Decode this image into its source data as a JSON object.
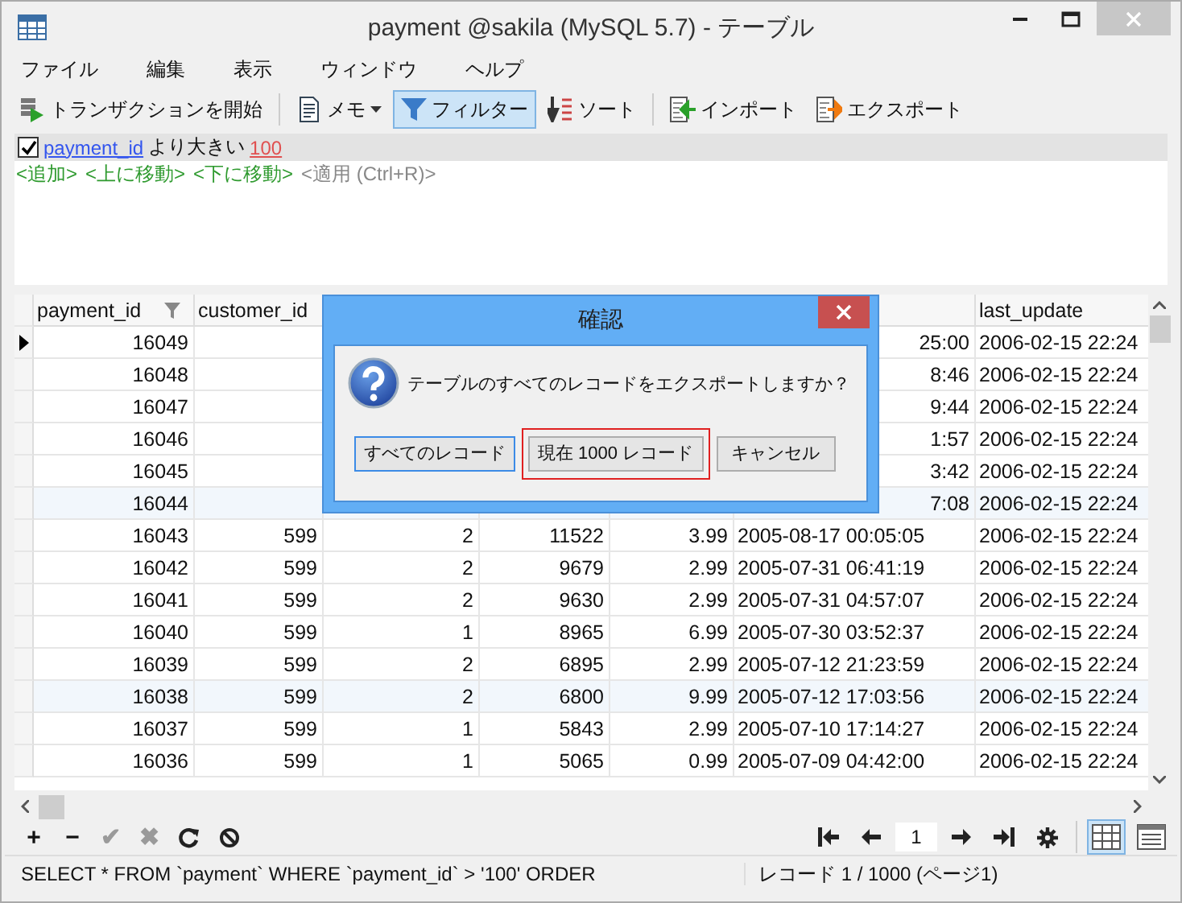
{
  "window": {
    "title": "payment @sakila (MySQL 5.7) - テーブル"
  },
  "menu": [
    "ファイル",
    "編集",
    "表示",
    "ウィンドウ",
    "ヘルプ"
  ],
  "toolbar": [
    {
      "label": "トランザクションを開始",
      "selected": false,
      "dropdown": false
    },
    {
      "label": "メモ",
      "selected": false,
      "dropdown": true
    },
    {
      "label": "フィルター",
      "selected": true,
      "dropdown": false
    },
    {
      "label": "ソート",
      "selected": false,
      "dropdown": false
    },
    {
      "label": "インポート",
      "selected": false,
      "dropdown": false
    },
    {
      "label": "エクスポート",
      "selected": false,
      "dropdown": false
    }
  ],
  "filter": {
    "checked": true,
    "field": "payment_id",
    "operator": "より大きい",
    "value": "100",
    "actions": [
      {
        "label": "<追加>",
        "disabled": false
      },
      {
        "label": "<上に移動>",
        "disabled": false
      },
      {
        "label": "<下に移動>",
        "disabled": false
      },
      {
        "label": "<適用 (Ctrl+R)>",
        "disabled": true
      }
    ]
  },
  "table": {
    "columns": [
      {
        "label": "payment_id"
      },
      {
        "label": "customer_id"
      },
      {},
      {},
      {},
      {},
      {
        "label": "last_update"
      }
    ],
    "rows": [
      {
        "current": true,
        "highlighted": false,
        "cells": [
          "16049",
          null,
          null,
          null,
          null,
          "25:00",
          "2006-02-15 22:24"
        ]
      },
      {
        "current": false,
        "highlighted": false,
        "cells": [
          "16048",
          null,
          null,
          null,
          null,
          "8:46",
          "2006-02-15 22:24"
        ]
      },
      {
        "current": false,
        "highlighted": false,
        "cells": [
          "16047",
          null,
          null,
          null,
          null,
          "9:44",
          "2006-02-15 22:24"
        ]
      },
      {
        "current": false,
        "highlighted": false,
        "cells": [
          "16046",
          null,
          null,
          null,
          null,
          "1:57",
          "2006-02-15 22:24"
        ]
      },
      {
        "current": false,
        "highlighted": false,
        "cells": [
          "16045",
          null,
          null,
          null,
          null,
          "3:42",
          "2006-02-15 22:24"
        ]
      },
      {
        "current": false,
        "highlighted": true,
        "cells": [
          "16044",
          null,
          null,
          null,
          null,
          "7:08",
          "2006-02-15 22:24"
        ]
      },
      {
        "current": false,
        "highlighted": false,
        "cells": [
          "16043",
          "599",
          "2",
          "11522",
          "3.99",
          "2005-08-17 00:05:05",
          "2006-02-15 22:24"
        ]
      },
      {
        "current": false,
        "highlighted": false,
        "cells": [
          "16042",
          "599",
          "2",
          "9679",
          "2.99",
          "2005-07-31 06:41:19",
          "2006-02-15 22:24"
        ]
      },
      {
        "current": false,
        "highlighted": false,
        "cells": [
          "16041",
          "599",
          "2",
          "9630",
          "2.99",
          "2005-07-31 04:57:07",
          "2006-02-15 22:24"
        ]
      },
      {
        "current": false,
        "highlighted": false,
        "cells": [
          "16040",
          "599",
          "1",
          "8965",
          "6.99",
          "2005-07-30 03:52:37",
          "2006-02-15 22:24"
        ]
      },
      {
        "current": false,
        "highlighted": false,
        "cells": [
          "16039",
          "599",
          "2",
          "6895",
          "2.99",
          "2005-07-12 21:23:59",
          "2006-02-15 22:24"
        ]
      },
      {
        "current": false,
        "highlighted": true,
        "cells": [
          "16038",
          "599",
          "2",
          "6800",
          "9.99",
          "2005-07-12 17:03:56",
          "2006-02-15 22:24"
        ]
      },
      {
        "current": false,
        "highlighted": false,
        "cells": [
          "16037",
          "599",
          "1",
          "5843",
          "2.99",
          "2005-07-10 17:14:27",
          "2006-02-15 22:24"
        ]
      },
      {
        "current": false,
        "highlighted": false,
        "cells": [
          "16036",
          "599",
          "1",
          "5065",
          "0.99",
          "2005-07-09 04:42:00",
          "2006-02-15 22:24"
        ]
      }
    ]
  },
  "bottom_tools": [
    {
      "label": "+",
      "disabled": false
    },
    {
      "label": "−",
      "disabled": false
    },
    {
      "label": "✔",
      "disabled": true
    },
    {
      "label": "✖",
      "disabled": true
    }
  ],
  "pager": {
    "page": "1"
  },
  "views": [
    {
      "selected": true
    },
    {
      "selected": false
    }
  ],
  "status_bar": {
    "sql": "SELECT * FROM `payment` WHERE `payment_id` > '100' ORDER",
    "records": "レコード 1 / 1000 (ページ1)"
  },
  "dialog": {
    "title": "確認",
    "message": "テーブルのすべてのレコードをエクスポートしますか？",
    "buttons": [
      {
        "label": "すべてのレコード",
        "focused": true,
        "outlined": false
      },
      {
        "label": "現在 1000 レコード",
        "focused": false,
        "outlined": true
      },
      {
        "label": "キャンセル",
        "focused": false,
        "outlined": false
      }
    ]
  }
}
